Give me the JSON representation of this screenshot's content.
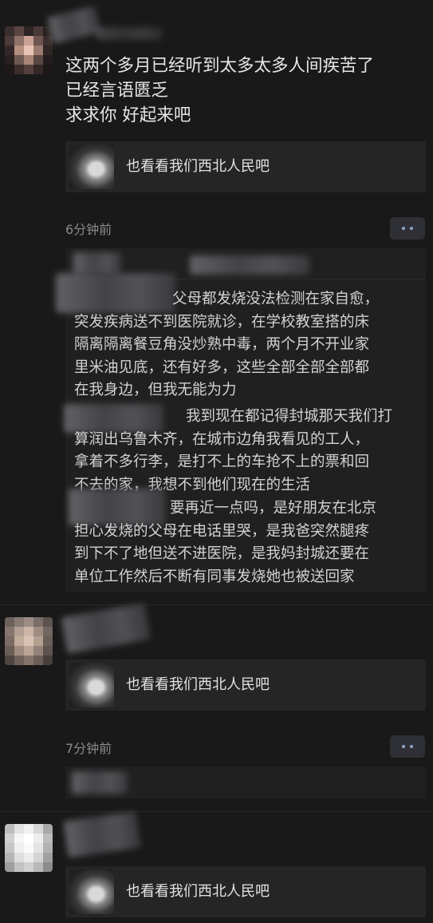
{
  "posts": [
    {
      "text_lines": [
        "这两个多月已经听到太多太多人间疾苦了",
        "已经言语匮乏",
        "求求你 好起来吧"
      ],
      "share_title": "也看看我们西北人民吧",
      "time": "6分钟前",
      "comments": [
        {
          "lines": [
            "父母都发烧没法检测在家自愈，",
            "突发疾病送不到医院就诊，在学校教室搭的床",
            "隔离隔离餐豆角没炒熟中毒，两个月不开业家",
            "里米油见底，还有好多，这些全部全部全部都",
            "在我身边，但我无能为力"
          ]
        },
        {
          "lines": [
            "我到现在都记得封城那天我们打",
            "算润出乌鲁木齐，在城市边角我看见的工人，",
            "拿着不多行李，是打不上的车抢不上的票和回",
            "不去的家，我想不到他们现在的生活"
          ]
        },
        {
          "lines": [
            "要再近一点吗，是好朋友在北京",
            "担心发烧的父母在电话里哭，是我爸突然腿疼",
            "到下不了地但送不进医院，是我妈封城还要在",
            "单位工作然后不断有同事发烧她也被送回家"
          ]
        }
      ]
    },
    {
      "share_title": "也看看我们西北人民吧",
      "time": "7分钟前"
    },
    {
      "share_title": "也看看我们西北人民吧"
    }
  ],
  "icons": {
    "more": "more-dots-icon",
    "thumb": "share-thumbnail-image"
  }
}
